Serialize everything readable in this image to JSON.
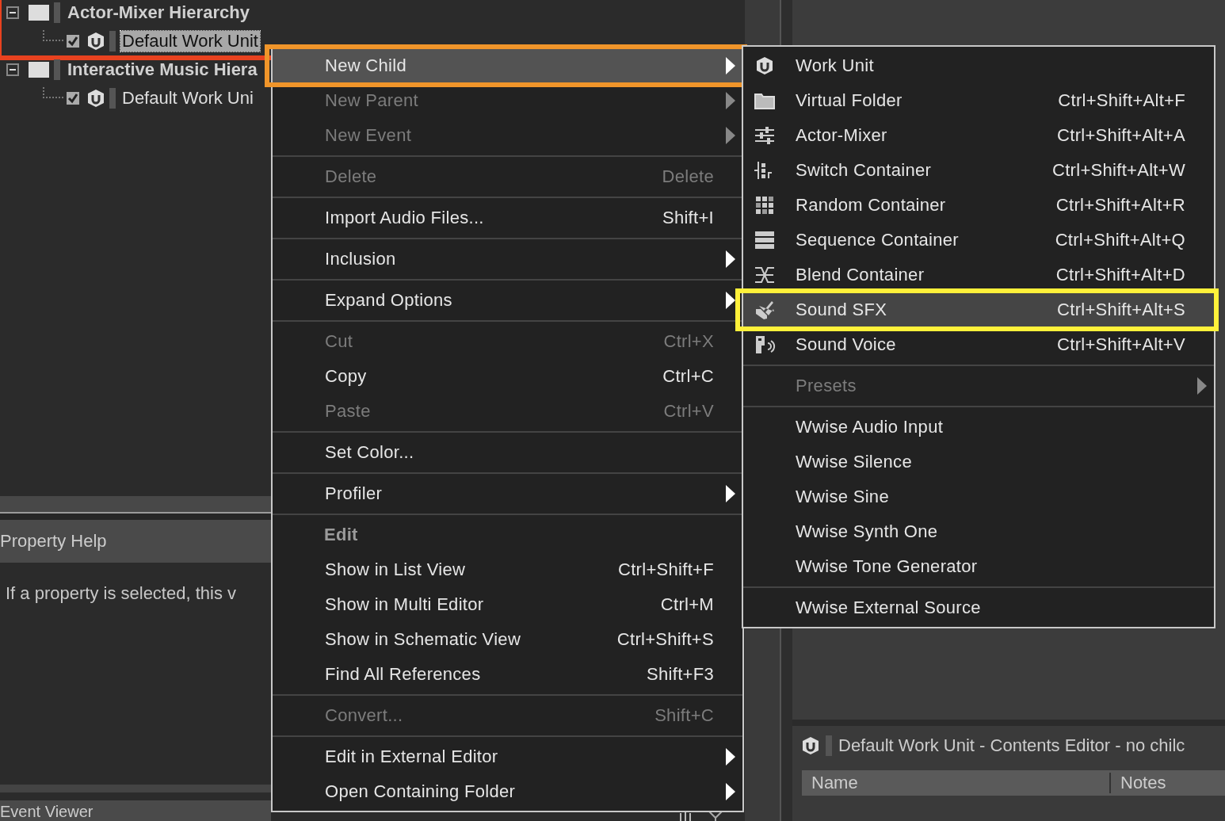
{
  "tree": [
    {
      "label": "Actor-Mixer Hierarchy",
      "expanded": true,
      "color": "#e8421f",
      "children": [
        {
          "label": "Default Work Unit",
          "checked": true,
          "selected": true
        }
      ]
    },
    {
      "label": "Interactive Music Hiera",
      "expanded": true,
      "children": [
        {
          "label": "Default Work Uni",
          "checked": true,
          "selected": false
        }
      ]
    }
  ],
  "property_help": {
    "title": "Property Help",
    "text": "If a property is selected, this v"
  },
  "event_viewer": {
    "title": "Event Viewer"
  },
  "contents_editor": {
    "title": "Default Work Unit - Contents Editor - no chilc",
    "columns": [
      "Name",
      "Notes"
    ]
  },
  "context_menu": [
    {
      "kind": "item",
      "label": "New Child",
      "submenu": true,
      "disabled": false,
      "selected": true,
      "color": "#f0952a"
    },
    {
      "kind": "item",
      "label": "New Parent",
      "submenu": true,
      "disabled": true,
      "selected": false
    },
    {
      "kind": "item",
      "label": "New Event",
      "submenu": true,
      "disabled": true,
      "selected": false
    },
    {
      "kind": "separator"
    },
    {
      "kind": "item",
      "label": "Delete",
      "shortcut": "Delete",
      "disabled": true,
      "selected": false
    },
    {
      "kind": "separator"
    },
    {
      "kind": "item",
      "label": "Import Audio Files...",
      "shortcut": "Shift+I",
      "disabled": false,
      "selected": false
    },
    {
      "kind": "separator"
    },
    {
      "kind": "item",
      "label": "Inclusion",
      "submenu": true,
      "disabled": false,
      "selected": false
    },
    {
      "kind": "separator"
    },
    {
      "kind": "item",
      "label": "Expand Options",
      "submenu": true,
      "disabled": false,
      "selected": false
    },
    {
      "kind": "separator"
    },
    {
      "kind": "item",
      "label": "Cut",
      "shortcut": "Ctrl+X",
      "disabled": true,
      "selected": false
    },
    {
      "kind": "item",
      "label": "Copy",
      "shortcut": "Ctrl+C",
      "disabled": false,
      "selected": false
    },
    {
      "kind": "item",
      "label": "Paste",
      "shortcut": "Ctrl+V",
      "disabled": true,
      "selected": false
    },
    {
      "kind": "separator"
    },
    {
      "kind": "item",
      "label": "Set Color...",
      "disabled": false,
      "selected": false
    },
    {
      "kind": "separator"
    },
    {
      "kind": "item",
      "label": "Profiler",
      "submenu": true,
      "disabled": false,
      "selected": false
    },
    {
      "kind": "separator"
    },
    {
      "kind": "header",
      "label": "Edit"
    },
    {
      "kind": "item",
      "label": "Show in List View",
      "shortcut": "Ctrl+Shift+F",
      "disabled": false,
      "selected": false
    },
    {
      "kind": "item",
      "label": "Show in Multi Editor",
      "shortcut": "Ctrl+M",
      "disabled": false,
      "selected": false
    },
    {
      "kind": "item",
      "label": "Show in Schematic View",
      "shortcut": "Ctrl+Shift+S",
      "disabled": false,
      "selected": false
    },
    {
      "kind": "item",
      "label": "Find All References",
      "shortcut": "Shift+F3",
      "disabled": false,
      "selected": false
    },
    {
      "kind": "separator"
    },
    {
      "kind": "item",
      "label": "Convert...",
      "shortcut": "Shift+C",
      "disabled": true,
      "selected": false
    },
    {
      "kind": "separator"
    },
    {
      "kind": "item",
      "label": "Edit in External Editor",
      "submenu": true,
      "disabled": false,
      "selected": false
    },
    {
      "kind": "item",
      "label": "Open Containing Folder",
      "submenu": true,
      "disabled": false,
      "selected": false
    }
  ],
  "submenu": [
    {
      "kind": "item",
      "label": "Work Unit",
      "disabled": false,
      "selected": false
    },
    {
      "kind": "item",
      "label": "Virtual Folder",
      "shortcut": "Ctrl+Shift+Alt+F",
      "disabled": false,
      "selected": false
    },
    {
      "kind": "item",
      "label": "Actor-Mixer",
      "shortcut": "Ctrl+Shift+Alt+A",
      "disabled": false,
      "selected": false
    },
    {
      "kind": "item",
      "label": "Switch Container",
      "shortcut": "Ctrl+Shift+Alt+W",
      "disabled": false,
      "selected": false
    },
    {
      "kind": "item",
      "label": "Random Container",
      "shortcut": "Ctrl+Shift+Alt+R",
      "disabled": false,
      "selected": false
    },
    {
      "kind": "item",
      "label": "Sequence Container",
      "shortcut": "Ctrl+Shift+Alt+Q",
      "disabled": false,
      "selected": false
    },
    {
      "kind": "item",
      "label": "Blend Container",
      "shortcut": "Ctrl+Shift+Alt+D",
      "disabled": false,
      "selected": false
    },
    {
      "kind": "item",
      "label": "Sound SFX",
      "shortcut": "Ctrl+Shift+Alt+S",
      "disabled": false,
      "selected": true,
      "color": "#fff13a"
    },
    {
      "kind": "item",
      "label": "Sound Voice",
      "shortcut": "Ctrl+Shift+Alt+V",
      "disabled": false,
      "selected": false
    },
    {
      "kind": "separator"
    },
    {
      "kind": "item",
      "label": "Presets",
      "submenu": true,
      "disabled": true,
      "selected": false
    },
    {
      "kind": "separator"
    },
    {
      "kind": "item",
      "label": "Wwise Audio Input",
      "disabled": false,
      "selected": false
    },
    {
      "kind": "item",
      "label": "Wwise Silence",
      "disabled": false,
      "selected": false
    },
    {
      "kind": "item",
      "label": "Wwise Sine",
      "disabled": false,
      "selected": false
    },
    {
      "kind": "item",
      "label": "Wwise Synth One",
      "disabled": false,
      "selected": false
    },
    {
      "kind": "item",
      "label": "Wwise Tone Generator",
      "disabled": false,
      "selected": false
    },
    {
      "kind": "separator"
    },
    {
      "kind": "item",
      "label": "Wwise External Source",
      "disabled": false,
      "selected": false
    }
  ]
}
